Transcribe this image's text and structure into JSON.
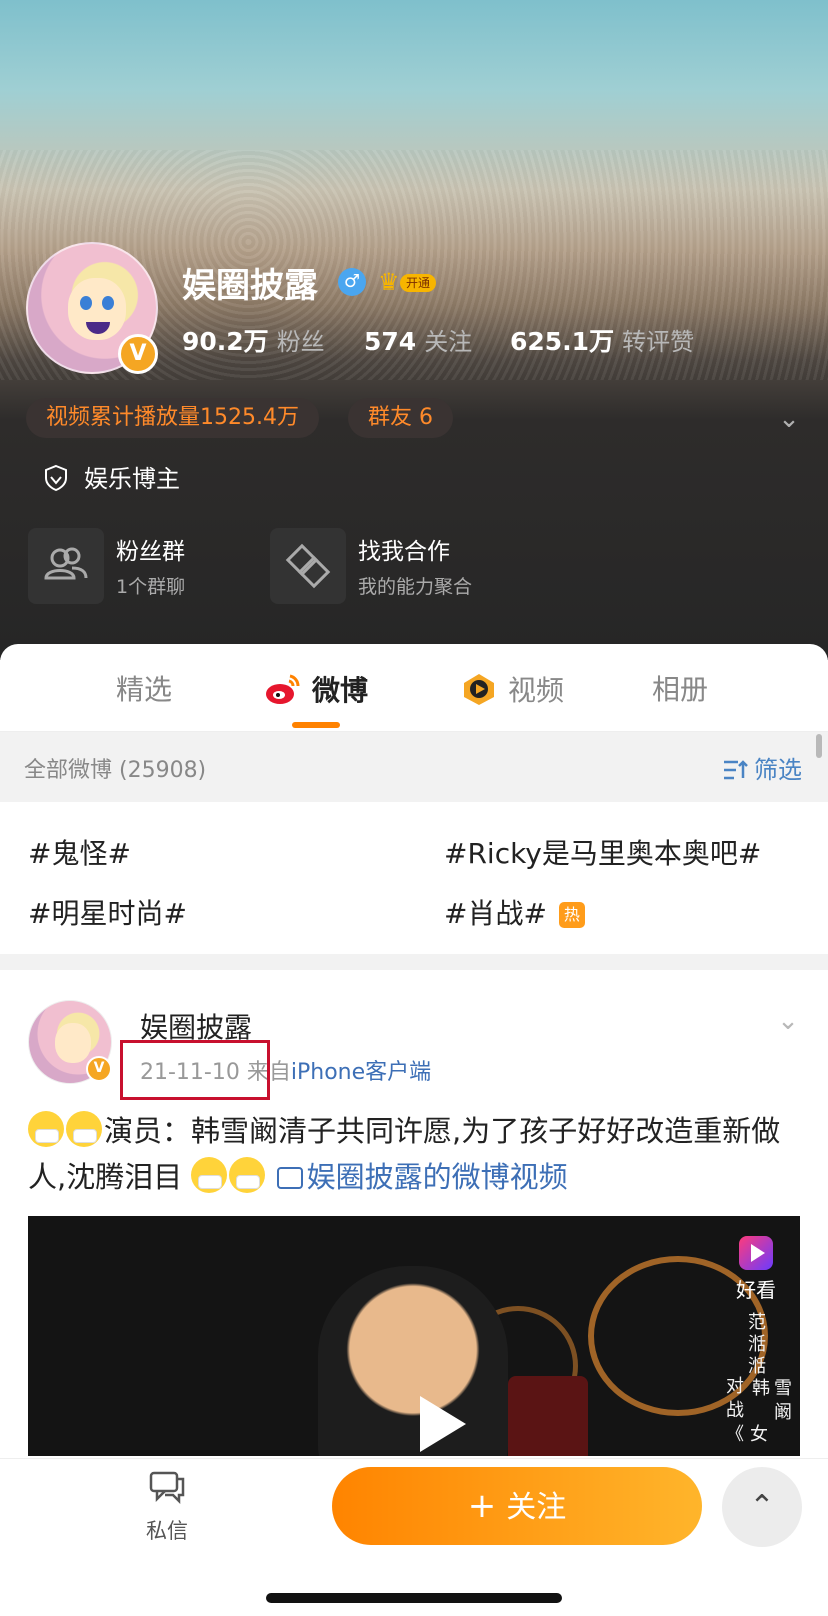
{
  "profile": {
    "name": "娱圈披露",
    "gender_icon": "♂",
    "vip_tag": "开通",
    "verified_badge": "V",
    "stats": [
      {
        "value": "90.2万",
        "label": "粉丝"
      },
      {
        "value": "574",
        "label": "关注"
      },
      {
        "value": "625.1万",
        "label": "转评赞"
      }
    ],
    "pills": [
      "视频累计播放量1525.4万",
      "群友 6"
    ],
    "certification": "娱乐博主",
    "cards": [
      {
        "title": "粉丝群",
        "subtitle": "1个群聊",
        "icon": "group-icon"
      },
      {
        "title": "找我合作",
        "subtitle": "我的能力聚合",
        "icon": "handshake-icon"
      }
    ]
  },
  "tabs": [
    "精选",
    "微博",
    "视频",
    "相册"
  ],
  "active_tab": "微博",
  "filter": {
    "count": "全部微博 (25908)",
    "label": "筛选"
  },
  "topics": [
    "#鬼怪#",
    "#明星时尚#",
    "#Ricky是马里奥本奥吧#",
    "#肖战#"
  ],
  "hot_badge": "热",
  "post": {
    "author": "娱圈披露",
    "date": "21-11-10",
    "from": "来自",
    "source": "iPhone客户端",
    "text_main": "演员：韩雪阚清子共同许愿,为了孩子好好改造重新做人,沈腾泪目",
    "video_link": "娱圈披露的微博视频",
    "video_brand": "好看",
    "video_overlay_text": [
      "范",
      "湉",
      "湉",
      "对",
      "战",
      "《",
      "女",
      "韩",
      "雪",
      "阚"
    ]
  },
  "bottom_bar": {
    "message_label": "私信",
    "follow_label": "关注",
    "follow_plus": "+",
    "up_icon": "⌃"
  },
  "colors": {
    "accent": "#ff8200",
    "link": "#3d6fb6",
    "pill_text": "#ff8a2a",
    "vip": "#f7b500"
  }
}
